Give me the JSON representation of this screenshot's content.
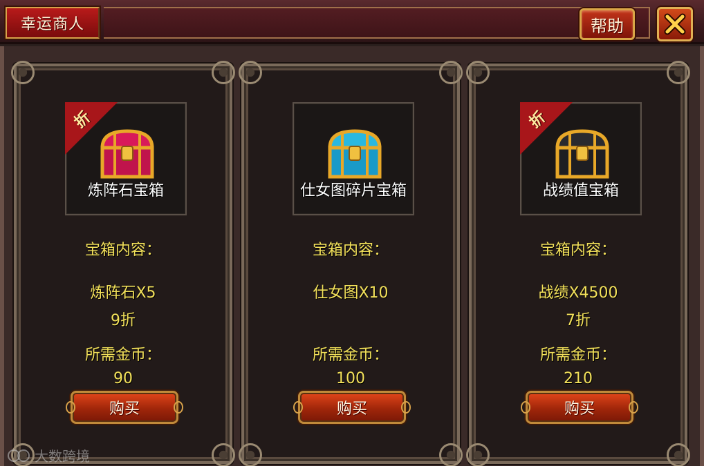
{
  "header": {
    "title": "幸运商人",
    "help_label": "帮助"
  },
  "colors": {
    "accent_gold": "#f2e05a",
    "tag_red": "#a8161a",
    "chest_red": "#d81a5a",
    "chest_blue": "#2ab8e0",
    "chest_black": "#2a2a2e"
  },
  "panels": [
    {
      "name": "炼阵石宝箱",
      "discount_tag": "折",
      "chest_icon": "red-chest-icon",
      "contents_label": "宝箱内容：",
      "contents": "炼阵石X5",
      "discount": "9折",
      "price_label": "所需金币：",
      "price": "90",
      "buy_label": "购买"
    },
    {
      "name": "仕女图碎片宝箱",
      "chest_icon": "blue-chest-icon",
      "contents_label": "宝箱内容：",
      "contents": "仕女图X10",
      "price_label": "所需金币：",
      "price": "100",
      "buy_label": "购买"
    },
    {
      "name": "战绩值宝箱",
      "discount_tag": "折",
      "chest_icon": "black-chest-icon",
      "contents_label": "宝箱内容：",
      "contents": "战绩X4500",
      "discount": "7折",
      "price_label": "所需金币：",
      "price": "210",
      "buy_label": "购买"
    }
  ],
  "watermark": "大数跨境"
}
